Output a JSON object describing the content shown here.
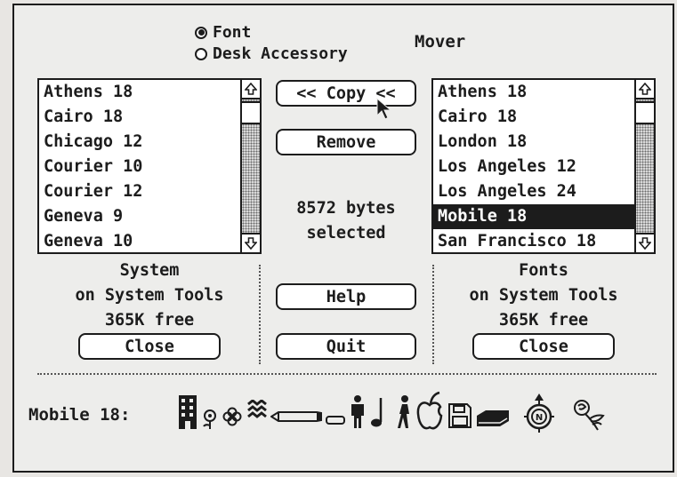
{
  "dialog": {
    "title": "Mover",
    "mode_options": [
      {
        "label": "Font",
        "selected": true
      },
      {
        "label": "Desk Accessory",
        "selected": false
      }
    ]
  },
  "left_list": {
    "items": [
      "Athens 18",
      "Cairo 18",
      "Chicago 12",
      "Courier 10",
      "Courier 12",
      "Geneva 9",
      "Geneva 10"
    ],
    "selected_index": -1
  },
  "right_list": {
    "items": [
      "Athens 18",
      "Cairo 18",
      "London 18",
      "Los Angeles 12",
      "Los Angeles 24",
      "Mobile 18",
      "San Francisco 18"
    ],
    "selected_index": 5
  },
  "center": {
    "copy_label": "<< Copy <<",
    "remove_label": "Remove",
    "bytes_line1": "8572 bytes",
    "bytes_line2": "selected",
    "help_label": "Help",
    "quit_label": "Quit"
  },
  "left_file": {
    "name": "System",
    "location": "on System Tools",
    "free": "365K free",
    "close_label": "Close"
  },
  "right_file": {
    "name": "Fonts",
    "location": "on System Tools",
    "free": "365K free",
    "close_label": "Close"
  },
  "sample": {
    "label": "Mobile 18:",
    "glyphs": [
      "building-icon",
      "flower-icon",
      "clover-icon",
      "wave-icon",
      "pencil-icon",
      "eraser-icon",
      "person-icon",
      "music-note-icon",
      "walking-figure-icon",
      "apple-icon",
      "floppy-disk-icon",
      "book-icon",
      "compass-icon",
      "rose-icon"
    ]
  },
  "colors": {
    "ink": "#1c1c1c",
    "paper": "#ededeb",
    "list_bg": "#ffffff"
  }
}
